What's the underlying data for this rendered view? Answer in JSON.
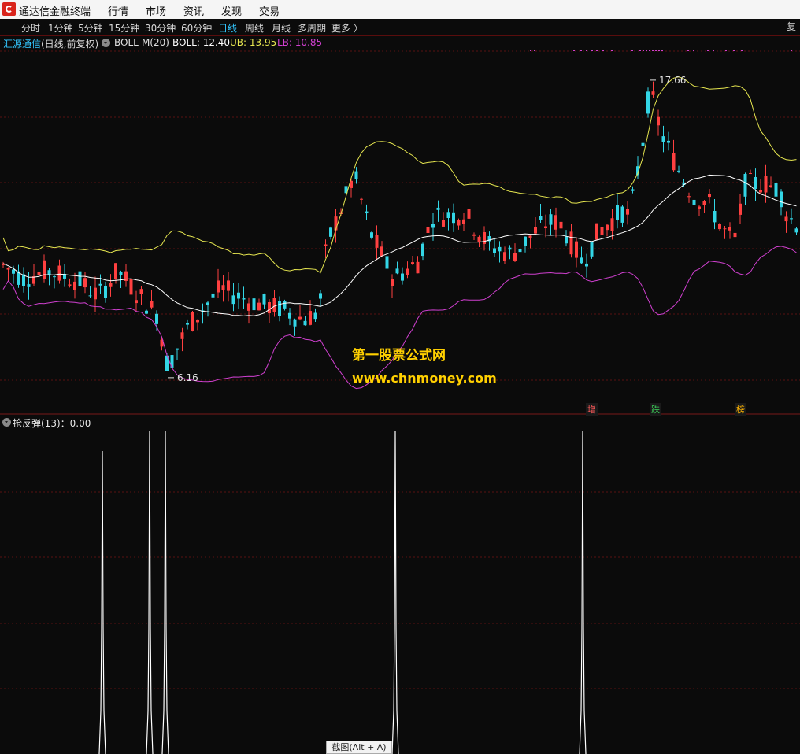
{
  "app": {
    "title": "通达信金融终端",
    "menu": [
      "行情",
      "市场",
      "资讯",
      "发现",
      "交易"
    ]
  },
  "periods": [
    "分时",
    "1分钟",
    "5分钟",
    "15分钟",
    "30分钟",
    "60分钟",
    "日线",
    "周线",
    "月线",
    "多周期",
    "更多 〉"
  ],
  "active_period": "日线",
  "right_button": "复权",
  "info": {
    "stock": "汇源通信",
    "mode": "(日线,前复权)",
    "indicator": "BOLL-M(20)",
    "boll": "BOLL: 12.40",
    "ub": "UB: 13.95",
    "lb": "LB: 10.85"
  },
  "subchart": {
    "title": "抢反弹(13)：0.00"
  },
  "tags": [
    "增",
    "跌",
    "榜"
  ],
  "watermark": {
    "line1": "第一股票公式网",
    "line2": "www.chnmoney.com"
  },
  "hint": "截图(Alt + A)",
  "colors": {
    "up": "#ff4040",
    "down": "#33d6e6",
    "mid": "#ffffff",
    "ub": "#e6e650",
    "lb": "#d040d0",
    "accent": "#33c7ff"
  },
  "chart_data": {
    "type": "candlestick",
    "series": [
      {
        "name": "BOLL",
        "last": 12.4
      },
      {
        "name": "UB",
        "last": 13.95
      },
      {
        "name": "LB",
        "last": 10.85
      }
    ],
    "annotations": [
      {
        "label": "17.66",
        "value": 17.66,
        "kind": "high"
      },
      {
        "label": "6.16",
        "value": 6.16,
        "kind": "low"
      }
    ],
    "price_range": [
      5.0,
      18.6
    ],
    "grid": true,
    "subchart": {
      "name": "抢反弹(13)",
      "value": 0.0,
      "spikes": 5
    }
  }
}
